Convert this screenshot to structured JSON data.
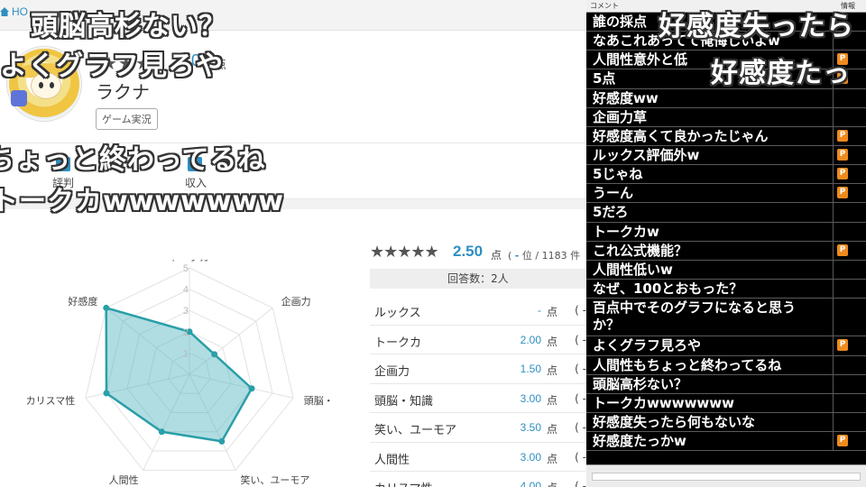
{
  "header": {
    "home_label": "HO"
  },
  "profile": {
    "stars": "★★★",
    "score_fragment": "0",
    "score_unit": "点",
    "name": "ラクナ",
    "genre_tag": "ゲーム実況"
  },
  "sections": {
    "label_left": "評判",
    "label_right": "収入"
  },
  "rating": {
    "stars": "★★★★★",
    "value": "2.50",
    "unit": "点",
    "rank_open": "(",
    "rank_dash": "-",
    "rank_text": "位 / 1183 件",
    "answers": "回答数：2人"
  },
  "categories": [
    {
      "name": "ルックス",
      "score": "-",
      "unit": "点",
      "rank": "( -"
    },
    {
      "name": "トークカ",
      "score": "2.00",
      "unit": "点",
      "rank": "( -"
    },
    {
      "name": "企画力",
      "score": "1.50",
      "unit": "点",
      "rank": "( -"
    },
    {
      "name": "頭脳・知識",
      "score": "3.00",
      "unit": "点",
      "rank": "( -"
    },
    {
      "name": "笑い、ユーモア",
      "score": "3.50",
      "unit": "点",
      "rank": "( -"
    },
    {
      "name": "人間性",
      "score": "3.00",
      "unit": "点",
      "rank": "( -"
    },
    {
      "name": "カリスマ性",
      "score": "4.00",
      "unit": "点",
      "rank": "( -"
    }
  ],
  "chart_data": {
    "type": "radar",
    "axes": [
      "トークカ",
      "企画力",
      "頭脳・知識",
      "笑い、ユーモア",
      "人間性",
      "カリスマ性",
      "好感度"
    ],
    "values": [
      2.0,
      1.5,
      3.0,
      3.5,
      3.0,
      4.0,
      5.0
    ],
    "rmax": 5,
    "ticks": [
      "1",
      "2",
      "3",
      "4",
      "5"
    ],
    "fill_color": "#4fb3bf",
    "line_color": "#2a9fa8"
  },
  "panel": {
    "col_comment": "コメント",
    "col_info": "情報",
    "comments": [
      {
        "text": "誰の採点",
        "p": false
      },
      {
        "text": "なあこれあってて俺悔しいよw",
        "p": false
      },
      {
        "text": "人間性意外と低",
        "p": true
      },
      {
        "text": "5点",
        "p": true
      },
      {
        "text": "好感度ww",
        "p": false
      },
      {
        "text": "企画力草",
        "p": false
      },
      {
        "text": "好感度高くて良かったじゃん",
        "p": true
      },
      {
        "text": "ルックス評価外w",
        "p": true
      },
      {
        "text": "5じゃね",
        "p": true
      },
      {
        "text": "うーん",
        "p": true
      },
      {
        "text": "5だろ",
        "p": false
      },
      {
        "text": "トークカw",
        "p": false
      },
      {
        "text": "これ公式機能？",
        "p": true
      },
      {
        "text": "人間性低いw",
        "p": false
      },
      {
        "text": "なぜ、100とおもった？",
        "p": false
      },
      {
        "text": "百点中でそのグラフになると思うか？",
        "p": false,
        "tall": true
      },
      {
        "text": "よくグラフ見ろや",
        "p": true
      },
      {
        "text": "人間性もちょっと終わってるね",
        "p": false
      },
      {
        "text": "頭脳高杉ない？",
        "p": false
      },
      {
        "text": "トークカwwwwwww",
        "p": false
      },
      {
        "text": "好感度失ったら何もないな",
        "p": false
      },
      {
        "text": "好感度たっかw",
        "p": true
      }
    ],
    "p_label": "P"
  },
  "overlay": {
    "flow1": "頭脳高杉ない？",
    "flow2": "よくグラフ見ろや",
    "flow3": "ちょっと終わってるね",
    "flow4": "トークカwwwwwww",
    "flow5": "好感度失ったら",
    "flow6": "好感度たっ"
  }
}
